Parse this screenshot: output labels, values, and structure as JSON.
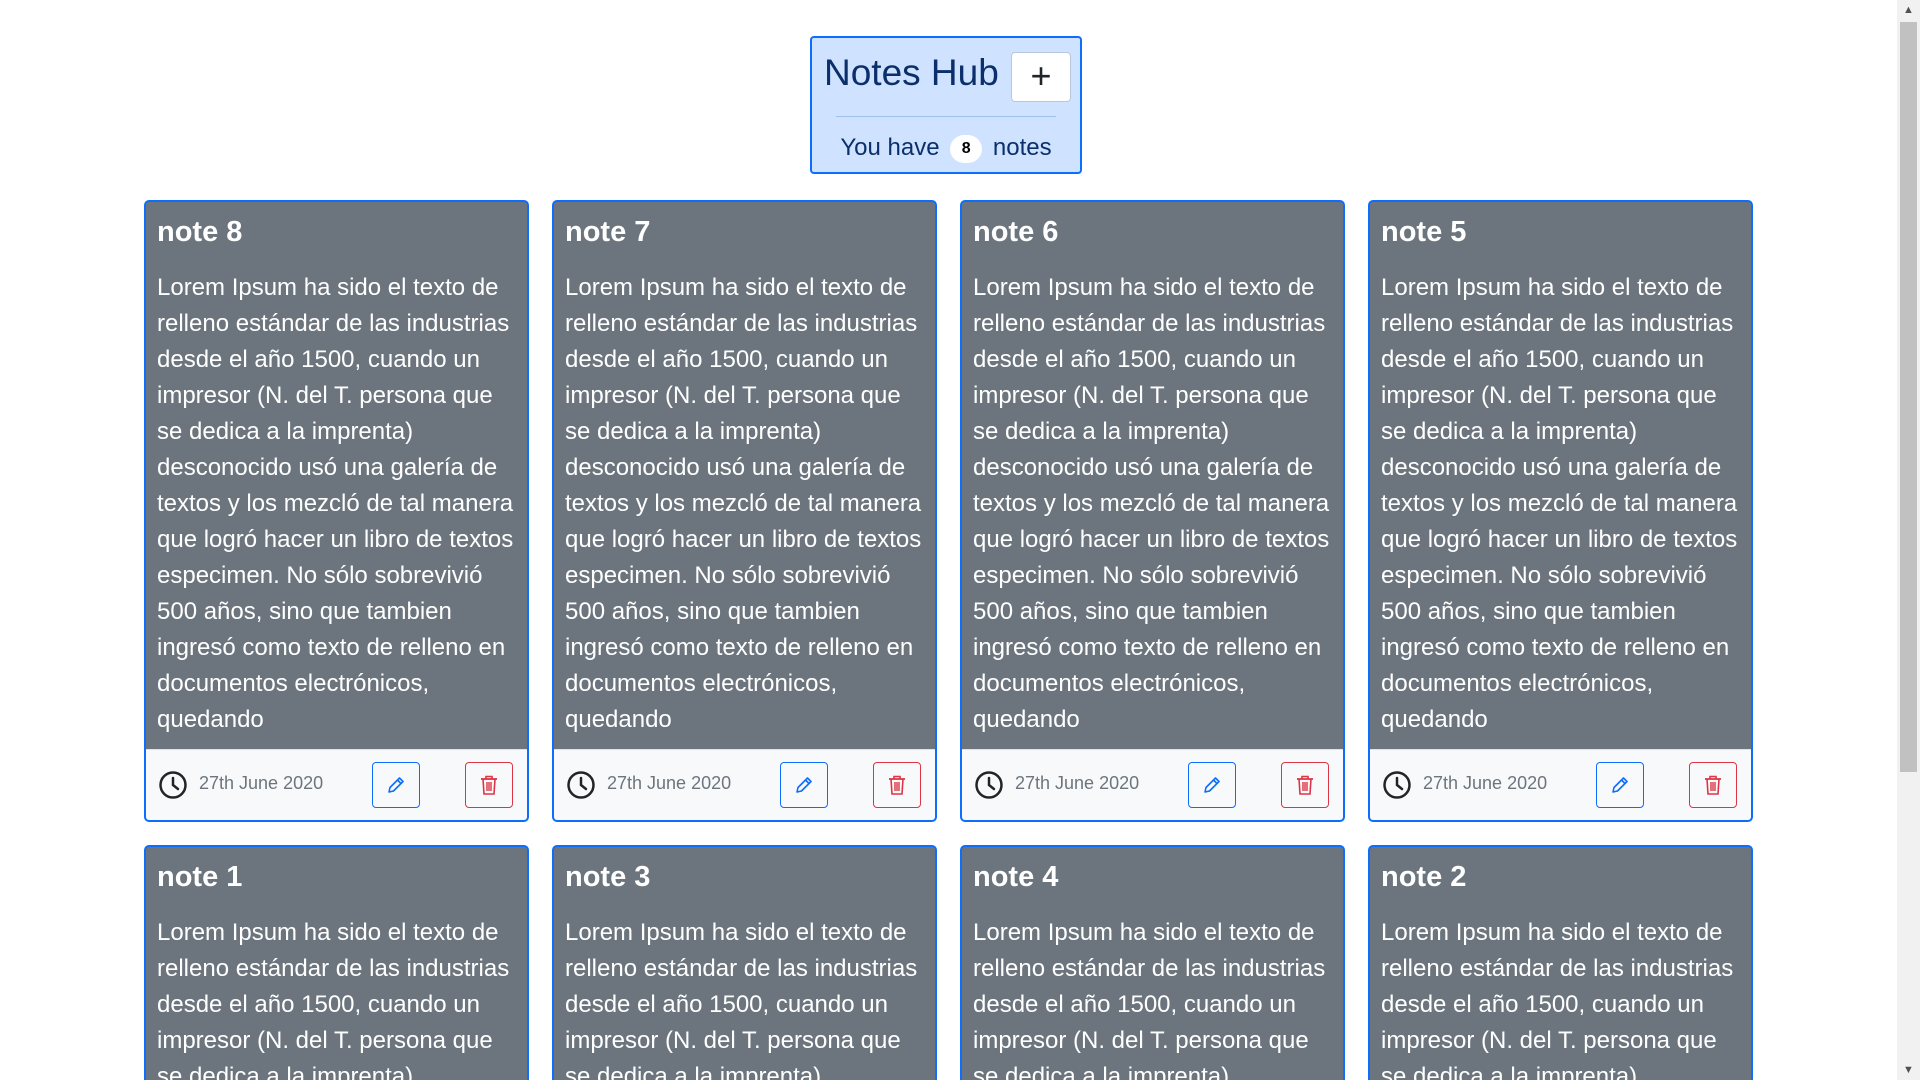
{
  "header": {
    "title": "Notes Hub",
    "add_label": "+",
    "count_prefix": "You have",
    "count": "8",
    "count_suffix": "notes"
  },
  "notes": [
    {
      "title": "note 8",
      "body": "Lorem Ipsum ha sido el texto de relleno estándar de las industrias desde el año 1500, cuando un impresor (N. del T. persona que se dedica a la imprenta) desconocido usó una galería de textos y los mezcló de tal manera que logró hacer un libro de textos especimen. No sólo sobrevivió 500 años, sino que tambien ingresó como texto de relleno en documentos electrónicos, quedando",
      "date": "27th June 2020"
    },
    {
      "title": "note 7",
      "body": "Lorem Ipsum ha sido el texto de relleno estándar de las industrias desde el año 1500, cuando un impresor (N. del T. persona que se dedica a la imprenta) desconocido usó una galería de textos y los mezcló de tal manera que logró hacer un libro de textos especimen. No sólo sobrevivió 500 años, sino que tambien ingresó como texto de relleno en documentos electrónicos, quedando",
      "date": "27th June 2020"
    },
    {
      "title": "note 6",
      "body": "Lorem Ipsum ha sido el texto de relleno estándar de las industrias desde el año 1500, cuando un impresor (N. del T. persona que se dedica a la imprenta) desconocido usó una galería de textos y los mezcló de tal manera que logró hacer un libro de textos especimen. No sólo sobrevivió 500 años, sino que tambien ingresó como texto de relleno en documentos electrónicos, quedando",
      "date": "27th June 2020"
    },
    {
      "title": "note 5",
      "body": "Lorem Ipsum ha sido el texto de relleno estándar de las industrias desde el año 1500, cuando un impresor (N. del T. persona que se dedica a la imprenta) desconocido usó una galería de textos y los mezcló de tal manera que logró hacer un libro de textos especimen. No sólo sobrevivió 500 años, sino que tambien ingresó como texto de relleno en documentos electrónicos, quedando",
      "date": "27th June 2020"
    },
    {
      "title": "note 1",
      "body": "Lorem Ipsum ha sido el texto de relleno estándar de las industrias desde el año 1500, cuando un impresor (N. del T. persona que se dedica a la imprenta)"
    },
    {
      "title": "note 3",
      "body": "Lorem Ipsum ha sido el texto de relleno estándar de las industrias desde el año 1500, cuando un impresor (N. del T. persona que se dedica a la imprenta)"
    },
    {
      "title": "note 4",
      "body": "Lorem Ipsum ha sido el texto de relleno estándar de las industrias desde el año 1500, cuando un impresor (N. del T. persona que se dedica a la imprenta)"
    },
    {
      "title": "note 2",
      "body": "Lorem Ipsum ha sido el texto de relleno estándar de las industrias desde el año 1500, cuando un impresor (N. del T. persona que se dedica a la imprenta)"
    }
  ],
  "icons": {
    "clock": "clock-icon",
    "edit": "pencil-icon",
    "delete": "trash-icon"
  },
  "colors": {
    "card_background": "#6c757d",
    "card_border": "#0d6efd",
    "header_background": "#cfe2ff",
    "edit_accent": "#0d6efd",
    "delete_accent": "#dc3545"
  }
}
